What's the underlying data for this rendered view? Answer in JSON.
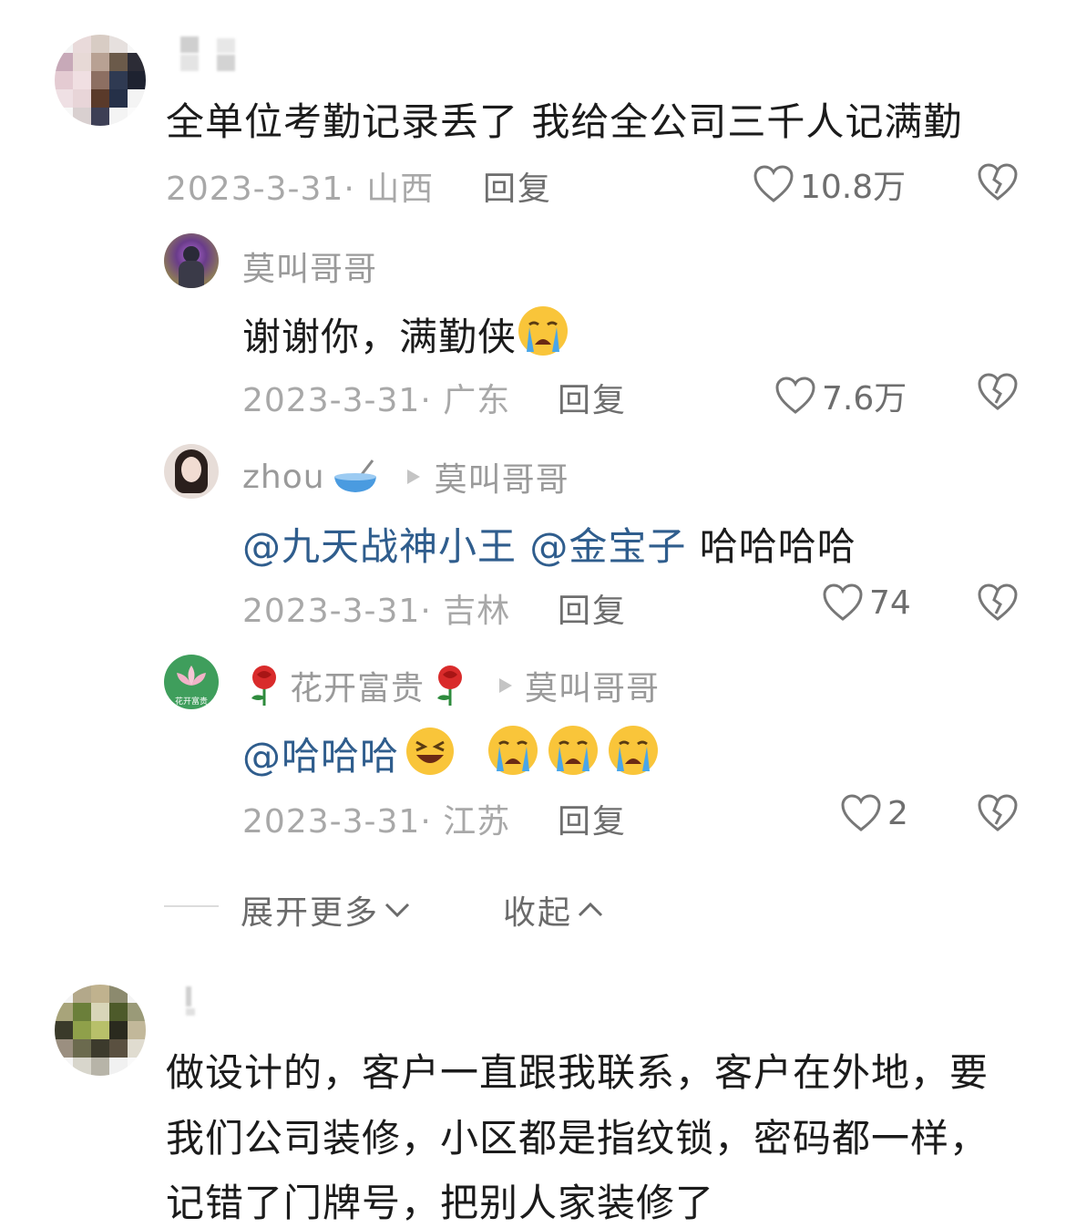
{
  "comments": [
    {
      "text": "全单位考勤记录丢了 我给全公司三千人记满勤",
      "date": "2023-3-31",
      "location": "山西",
      "reply_label": "回复",
      "likes": "10.8万",
      "replies": [
        {
          "user": "莫叫哥哥",
          "text": "谢谢你，满勤侠",
          "date": "2023-3-31",
          "location": "广东",
          "reply_label": "回复",
          "likes": "7.6万"
        },
        {
          "user": "zhou",
          "reply_to": "莫叫哥哥",
          "mentions": [
            "@九天战神小王",
            "@金宝子"
          ],
          "text": "哈哈哈哈",
          "date": "2023-3-31",
          "location": "吉林",
          "reply_label": "回复",
          "likes": "74"
        },
        {
          "user": "花开富贵",
          "avatar_text": "花开富贵",
          "reply_to": "莫叫哥哥",
          "mentions": [
            "@哈哈哈"
          ],
          "date": "2023-3-31",
          "location": "江苏",
          "reply_label": "回复",
          "likes": "2"
        }
      ],
      "expand_label": "展开更多",
      "collapse_label": "收起"
    },
    {
      "lines": [
        "做设计的，客户一直跟我联系，客户在外地，要",
        "我们公司装修，小区都是指纹锁，密码都一样，",
        "记错了门牌号，把别人家装修了"
      ]
    }
  ],
  "icons": [
    "heart-icon",
    "broken-heart-icon",
    "chevron-down-icon",
    "chevron-up-icon",
    "play-arrow-icon",
    "crying-emoji",
    "laughing-emoji",
    "rose-emoji",
    "bowl-emoji"
  ],
  "colors": {
    "mention": "#2f5d8d",
    "meta": "#a8a8a8",
    "action": "#6e6e6e"
  }
}
